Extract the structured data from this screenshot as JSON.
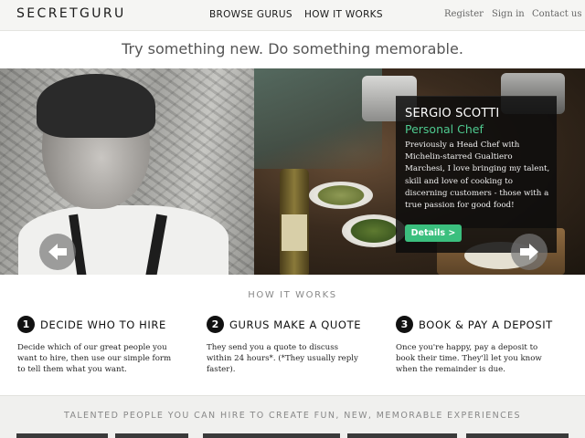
{
  "header": {
    "logo": "SECRETGURU",
    "main_nav": [
      "BROWSE GURUS",
      "HOW IT WORKS"
    ],
    "user_nav": [
      "Register",
      "Sign in",
      "Contact us"
    ]
  },
  "tagline": "Try something new. Do something memorable.",
  "hero": {
    "name": "SERGIO SCOTTI",
    "role": "Personal Chef",
    "description": "Previously a Head Chef with Michelin-starred Gualtiero Marchesi, I love bringing my talent, skill and love of cooking to discerning customers - those with a true passion for good food!",
    "details_label": "Details >",
    "prev_icon": "arrow-left-icon",
    "next_icon": "arrow-right-icon"
  },
  "how_it_works": {
    "title": "HOW IT WORKS",
    "steps": [
      {
        "number": "1",
        "title": "DECIDE WHO TO HIRE",
        "text": "Decide which of our great people you want to hire, then use our simple form to tell them what you want."
      },
      {
        "number": "2",
        "title": "GURUS MAKE A QUOTE",
        "text": "They send you a quote to discuss within 24 hours*. (*They usually reply faster)."
      },
      {
        "number": "3",
        "title": "BOOK & PAY A DEPOSIT",
        "text": "Once you're happy, pay a deposit to book their time. They'll let you know when the remainder is due."
      }
    ]
  },
  "talented": {
    "title": "TALENTED PEOPLE YOU CAN HIRE TO CREATE FUN, NEW, MEMORABLE EXPERIENCES"
  },
  "colors": {
    "accent_green": "#3bbf7e",
    "role_green": "#4ec98f",
    "panel_bg": "#0c0c0c"
  }
}
